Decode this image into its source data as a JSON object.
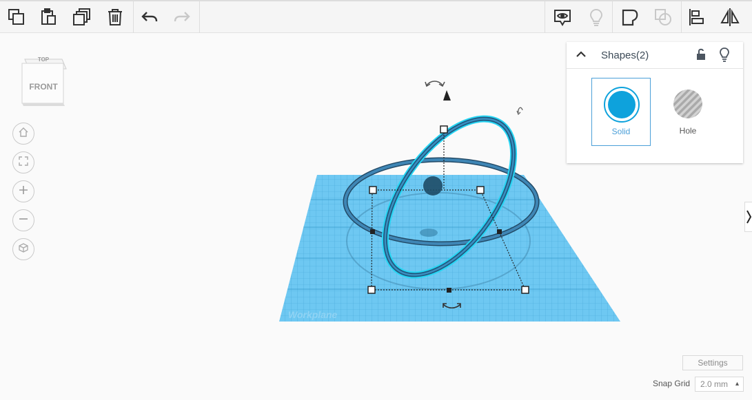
{
  "toolbar": {
    "left_tools": [
      "copy-icon",
      "paste-icon",
      "duplicate-icon",
      "delete-icon",
      "undo-icon",
      "redo-icon"
    ],
    "right_tools": [
      "show-all-icon",
      "light-bulb-icon",
      "group-icon",
      "ungroup-icon",
      "align-icon",
      "mirror-icon"
    ]
  },
  "navcube": {
    "top_label": "TOP",
    "front_label": "FRONT"
  },
  "view_controls": [
    "home-icon",
    "fit-view-icon",
    "zoom-in-icon",
    "zoom-out-icon",
    "perspective-icon"
  ],
  "workplane": {
    "label": "Workplane",
    "color": "#5fc0ee"
  },
  "shapes_panel": {
    "title": "Shapes(2)",
    "solid_label": "Solid",
    "hole_label": "Hole",
    "solid_color": "#0ea2dc",
    "accent_color": "#4a9fd8"
  },
  "settings_label": "Settings",
  "snap_grid": {
    "label": "Snap Grid",
    "value": "2.0 mm",
    "arrow": "▴"
  }
}
